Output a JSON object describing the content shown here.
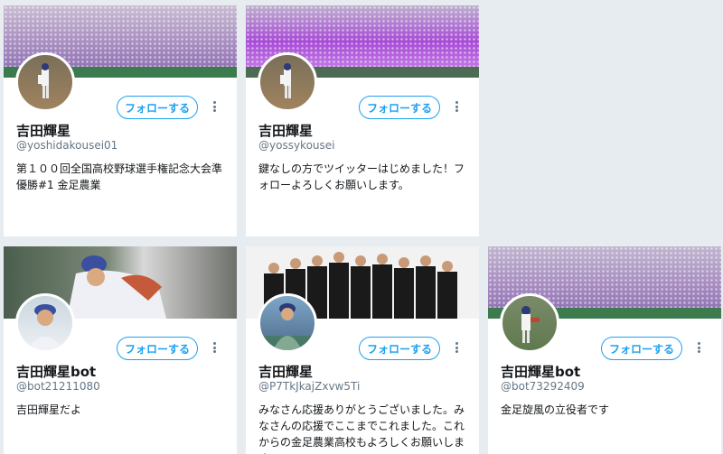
{
  "cards": [
    {
      "name": "吉田輝星",
      "handle": "@yoshidakousei01",
      "bio": "第１００回全国高校野球選手権記念大会準優勝#1 金足農業",
      "follow_label": "フォローする",
      "banner_color": "#b9a6c9",
      "stand_color": "#8c5bbd"
    },
    {
      "name": "吉田輝星",
      "handle": "@yossykousei",
      "bio": "鍵なしの方でツイッターはじめました！フォローよろしくお願いします。",
      "follow_label": "フォローする",
      "banner_color": "#a58bc4",
      "stand_color": "#9b45d8"
    },
    {
      "name": "吉田輝星bot",
      "handle": "@bot21211080",
      "bio": "吉田輝星だよ",
      "follow_label": "フォローする",
      "banner_color": "#5e6b5a",
      "stand_color": "#2d4f3a"
    },
    {
      "name": "吉田輝星",
      "handle": "@P7TkJkajZxvw5Ti",
      "bio": "みなさん応援ありがとうございました。みなさんの応援でここまでこれました。これからの金足農業高校もよろしくお願いします。",
      "follow_label": "フォローする",
      "banner_color": "#f2f2f2",
      "stand_color": "#1a1a1a"
    },
    {
      "name": "吉田輝星bot",
      "handle": "@bot73292409",
      "bio": "金足旋風の立役者です",
      "follow_label": "フォローする",
      "banner_color": "#a99bc4",
      "stand_color": "#7b5aa6"
    }
  ]
}
